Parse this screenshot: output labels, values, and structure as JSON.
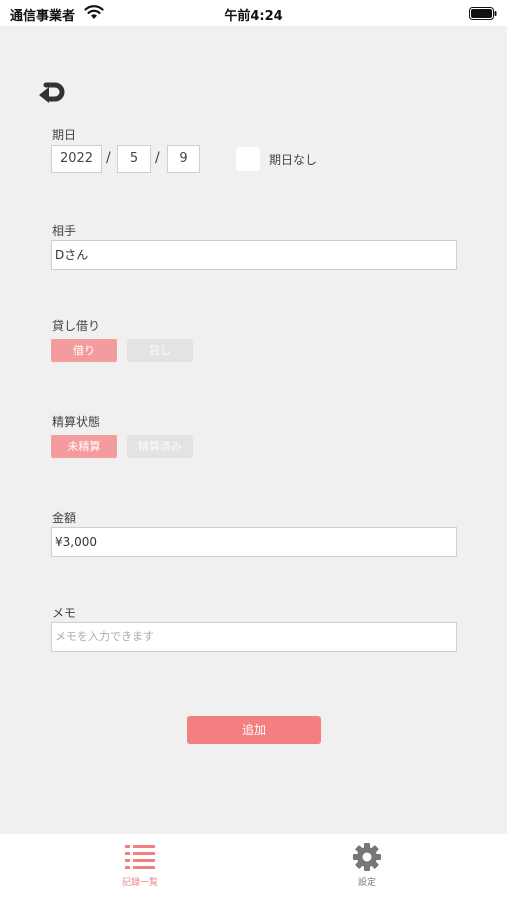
{
  "status_bar": {
    "carrier": "通信事業者",
    "time": "午前4:24"
  },
  "form": {
    "date": {
      "label": "期日",
      "year": "2022",
      "separator": "/",
      "month": "5",
      "day": "9",
      "no_date_label": "期日なし",
      "no_date_checked": false
    },
    "partner": {
      "label": "相手",
      "value": "Dさん"
    },
    "lend_borrow": {
      "label": "貸し借り",
      "options": [
        "借り",
        "貸し"
      ],
      "selected": "借り"
    },
    "settlement": {
      "label": "精算状態",
      "options": [
        "未精算",
        "精算済み"
      ],
      "selected": "未精算"
    },
    "amount": {
      "label": "金額",
      "value": "¥3,000"
    },
    "memo": {
      "label": "メモ",
      "value": "",
      "placeholder": "メモを入力できます"
    },
    "submit_label": "追加"
  },
  "tab_bar": {
    "items": [
      {
        "label": "記録一覧",
        "icon": "list-icon",
        "active": true
      },
      {
        "label": "設定",
        "icon": "gear-icon",
        "active": false
      }
    ]
  },
  "colors": {
    "accent": "#f47f81",
    "segment_active": "#f39c9e",
    "segment_inactive": "#e3e3e3",
    "background": "#f0f0f0"
  }
}
